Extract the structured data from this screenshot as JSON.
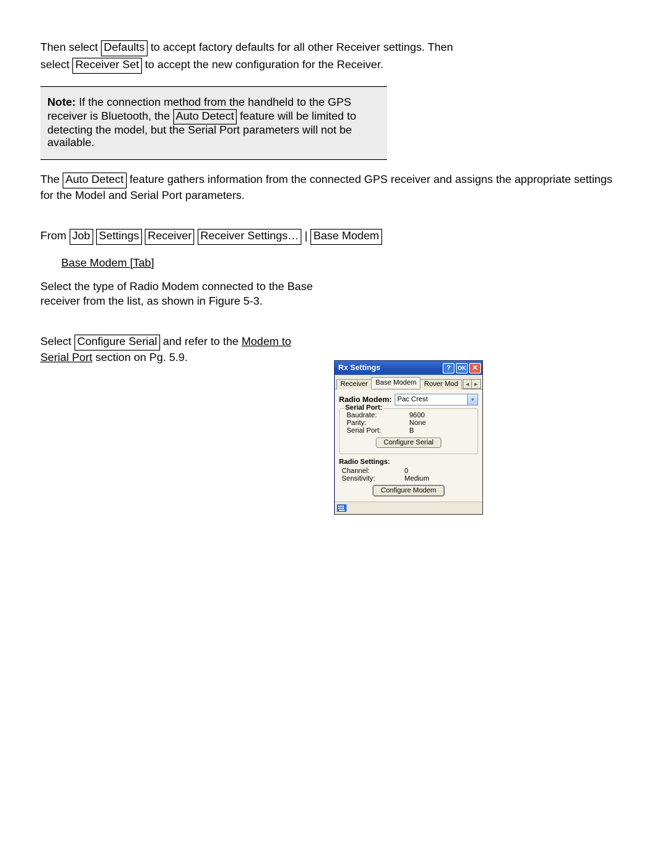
{
  "doc": {
    "para1": {
      "before": "Then select ",
      "btn": "Defaults",
      "after": " to accept factory defaults for all other Receiver settings. Then"
    },
    "para2": {
      "before": "select ",
      "btn": "Receiver Set",
      "after": " to accept the new configuration for the Receiver."
    },
    "note": {
      "label": "Note:",
      "text": " If the connection method from the handheld to the GPS receiver is Bluetooth, the ",
      "btn": "Auto Detect",
      "after": " feature will be limited to detecting the model, but the Serial Port parameters will not be available."
    },
    "para3": {
      "before": "The ",
      "btn": "Auto Detect",
      "after": " feature gathers information from the connected GPS receiver and assigns the appropriate settings for the Model and Serial Port parameters."
    },
    "nav": {
      "before": "From ",
      "b1": "Job",
      "b2": "Settings",
      "b3": "Receiver",
      "b4": "Receiver Settings…",
      "b5": "Base Modem",
      "sep": " | "
    },
    "heading": "Base Modem [Tab]",
    "figure_text": "Select the type of Radio Modem connected to the Base receiver from the list, as shown in Figure 5-3.",
    "configure_serial": {
      "before": "Select ",
      "btn": "Configure Serial",
      "after": " and refer to the ",
      "link": "Modem to Serial Port",
      "tail": " section on Pg. 5.9."
    }
  },
  "dialog": {
    "title": "Rx Settings",
    "tb": {
      "help": "?",
      "ok": "OK",
      "close": "✕"
    },
    "tabs": {
      "receiver": "Receiver",
      "base": "Base Modem",
      "rover": "Rover Mod"
    },
    "radio_modem_label": "Radio Modem:",
    "radio_modem_value": "Pac Crest",
    "serial_legend": "Serial Port:",
    "serial": {
      "baud_k": "Baudrate:",
      "baud_v": "9600",
      "parity_k": "Parity:",
      "parity_v": "None",
      "port_k": "Serial Port:",
      "port_v": "B"
    },
    "btn_configure_serial": "Configure Serial",
    "radio_settings_label": "Radio Settings:",
    "radio": {
      "channel_k": "Channel:",
      "channel_v": "0",
      "sens_k": "Sensitivity:",
      "sens_v": "Medium"
    },
    "btn_configure_modem": "Configure Modem"
  }
}
